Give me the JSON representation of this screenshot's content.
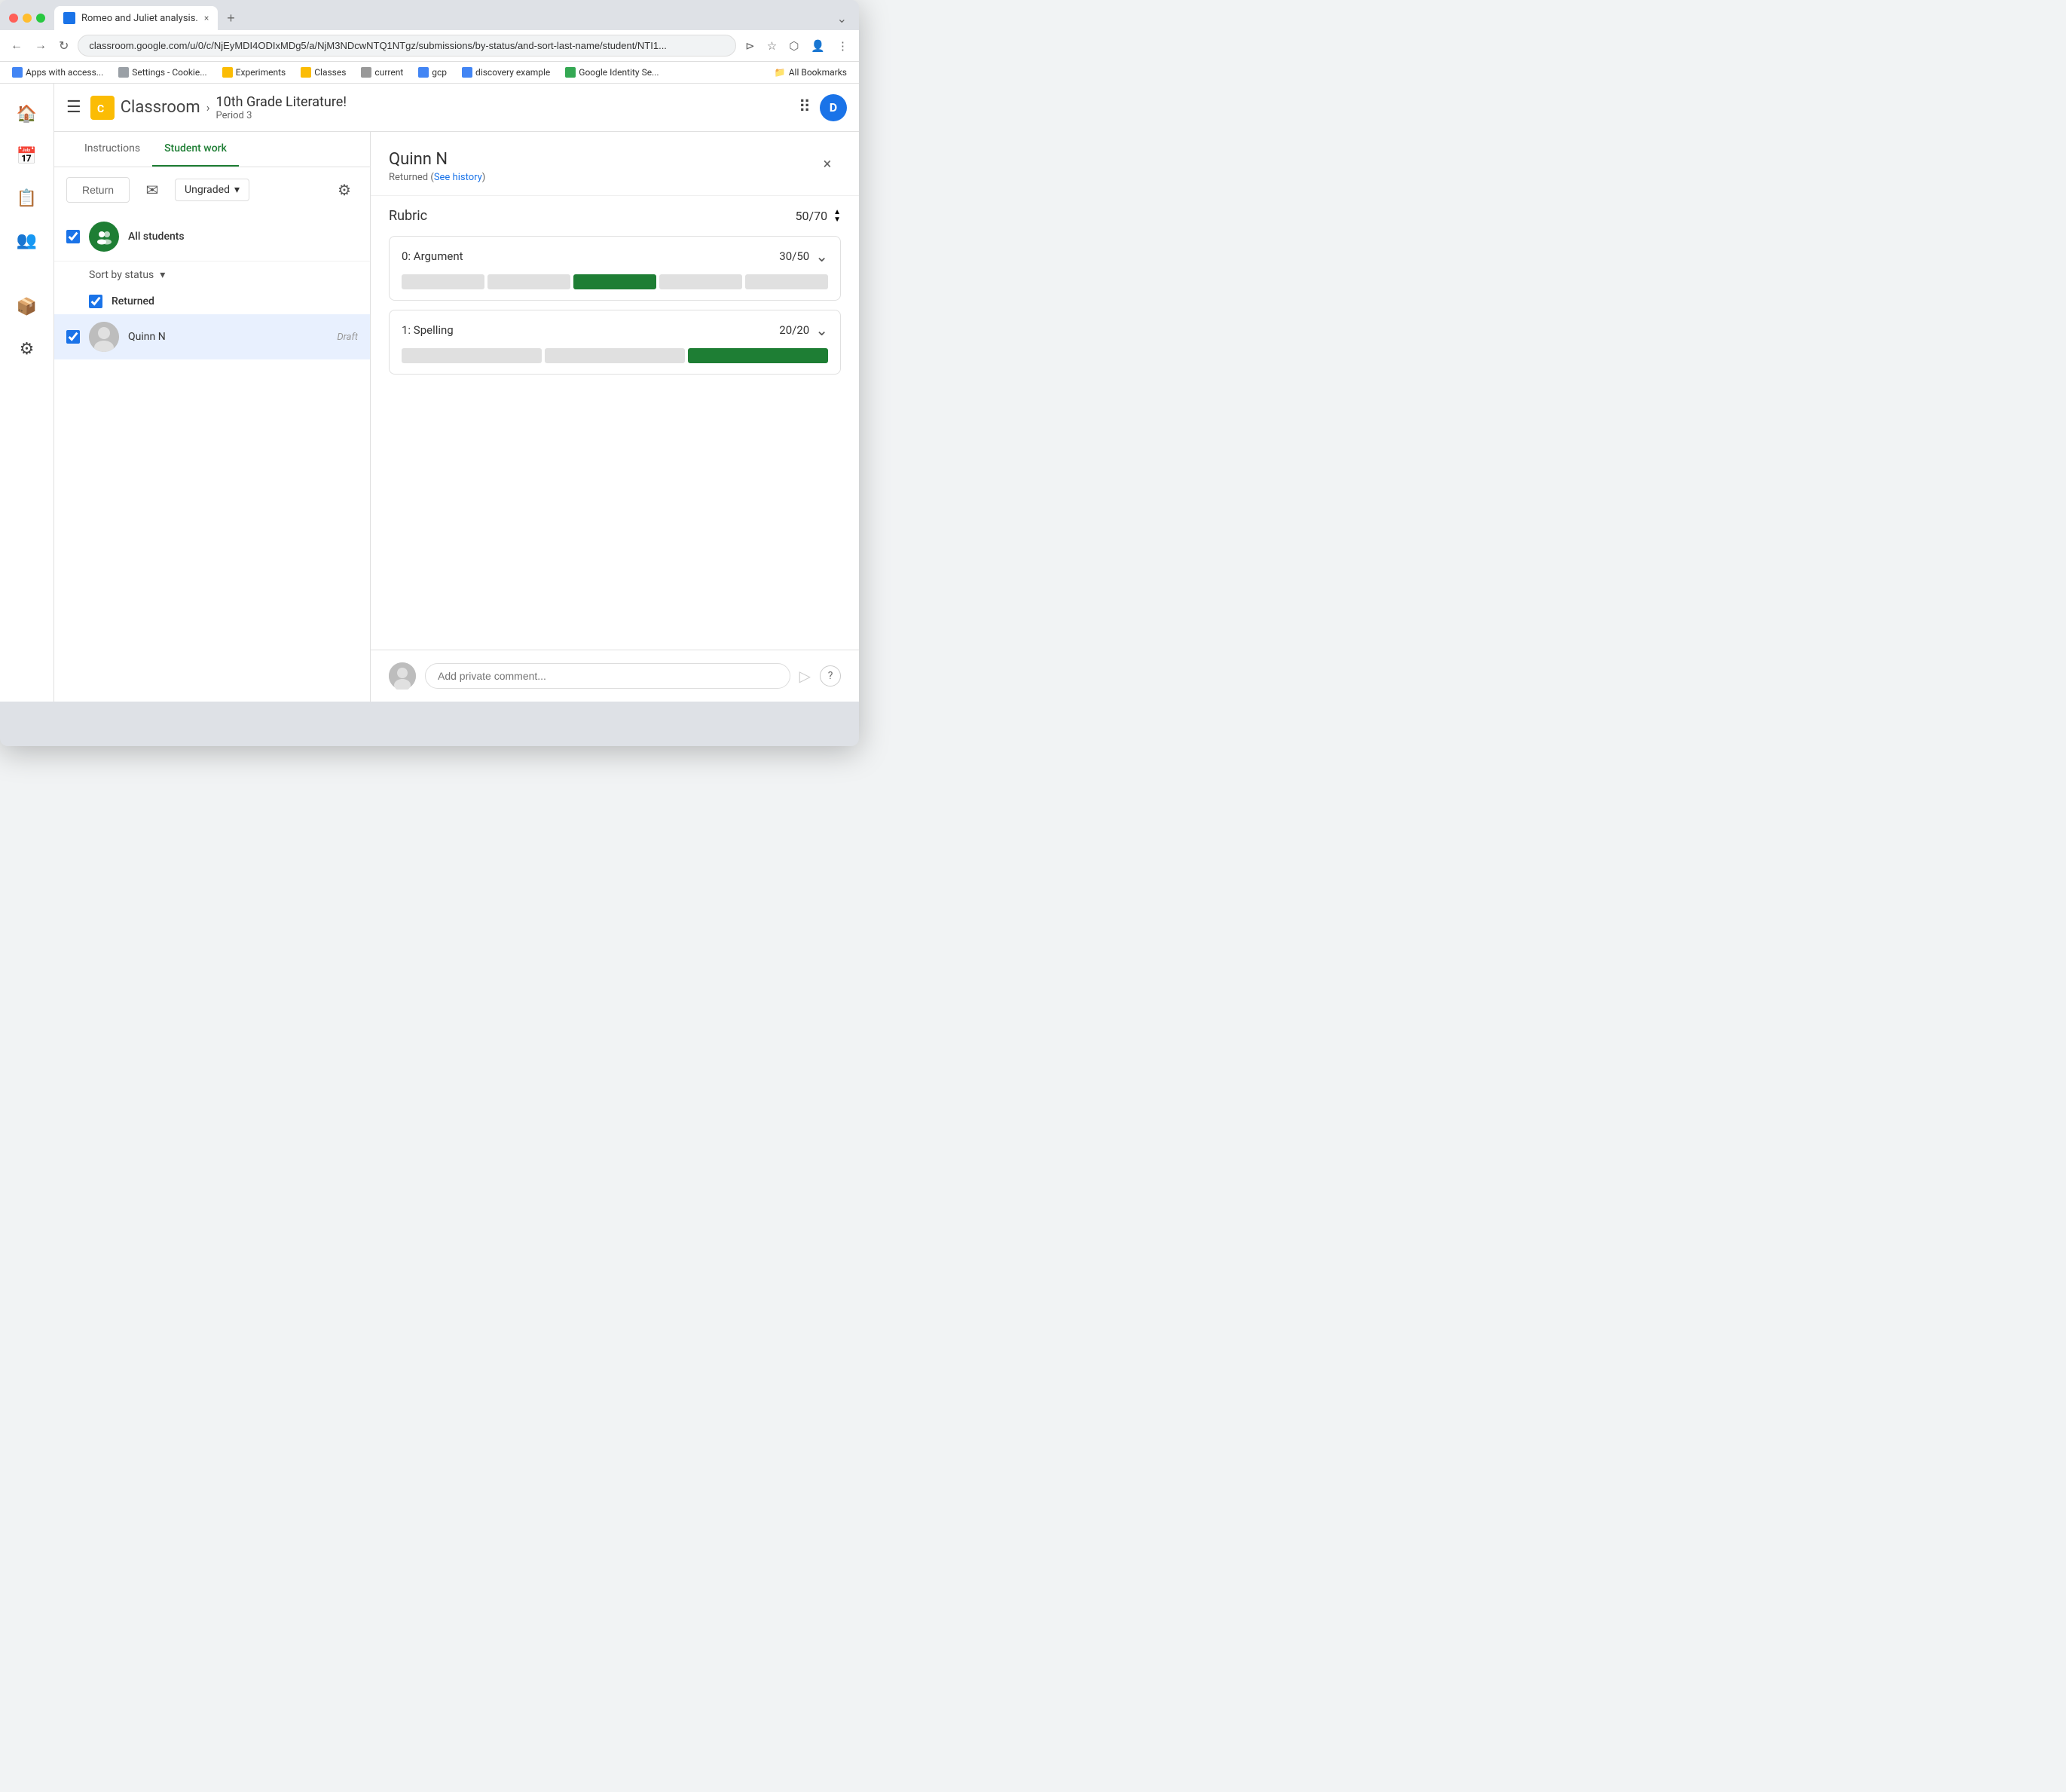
{
  "browser": {
    "tab_title": "Romeo and Juliet analysis.",
    "tab_new_label": "+",
    "address_bar": "classroom.google.com/u/0/c/NjEyMDI4ODIxMDg5/a/NjM3NDcwNTQ1NTgz/submissions/by-status/and-sort-last-name/student/NTI1...",
    "bookmarks": [
      {
        "label": "Apps with access...",
        "icon_color": "#4285f4"
      },
      {
        "label": "Settings - Cookie...",
        "icon_color": "#9aa0a6"
      },
      {
        "label": "Experiments",
        "icon_color": "#333"
      },
      {
        "label": "Classes",
        "icon_color": "#fbbc04"
      },
      {
        "label": "current",
        "icon_color": "#999"
      },
      {
        "label": "gcp",
        "icon_color": "#4285f4"
      },
      {
        "label": "discovery example",
        "icon_color": "#4285f4"
      },
      {
        "label": "Google Identity Se...",
        "icon_color": "#4285f4"
      },
      {
        "label": "All Bookmarks",
        "icon_color": "#999"
      }
    ]
  },
  "header": {
    "menu_icon": "☰",
    "logo_text": "Classroom",
    "logo_icon_text": "C",
    "breadcrumb_arrow": "›",
    "class_name": "10th Grade Literature!",
    "class_period": "Period 3",
    "apps_icon": "⠿",
    "avatar_letter": "D"
  },
  "sidebar_nav": {
    "items": [
      {
        "icon": "🏠",
        "name": "home"
      },
      {
        "icon": "📅",
        "name": "calendar"
      },
      {
        "icon": "📋",
        "name": "assignments"
      },
      {
        "icon": "👥",
        "name": "people"
      },
      {
        "icon": "📦",
        "name": "archive"
      },
      {
        "icon": "⚙",
        "name": "settings"
      }
    ]
  },
  "tabs": [
    {
      "label": "Instructions",
      "active": false
    },
    {
      "label": "Student work",
      "active": true
    }
  ],
  "toolbar": {
    "return_button_label": "Return",
    "email_icon": "✉",
    "status_label": "Ungraded",
    "dropdown_arrow": "▾",
    "settings_icon": "⚙"
  },
  "student_list": {
    "all_students_label": "All students",
    "sort_label": "Sort by status",
    "sort_arrow": "▾",
    "sections": [
      {
        "title": "Returned",
        "students": [
          {
            "name": "Quinn N",
            "status": "Draft",
            "selected": true
          }
        ]
      }
    ]
  },
  "student_detail": {
    "name": "Quinn N",
    "status_text": "Returned (See history)",
    "close_icon": "×",
    "rubric": {
      "title": "Rubric",
      "total_score": "50",
      "total_possible": "70",
      "items": [
        {
          "title": "0: Argument",
          "score": "30",
          "possible": "50",
          "segments": [
            0,
            0,
            1,
            0,
            0
          ],
          "active_segment": 2
        },
        {
          "title": "1: Spelling",
          "score": "20",
          "possible": "20",
          "segments": [
            0,
            0,
            1
          ],
          "active_segment": 2
        }
      ]
    }
  },
  "comment_area": {
    "placeholder": "Add private comment...",
    "send_icon": "▶",
    "help_icon": "?"
  },
  "colors": {
    "green_primary": "#1e7e34",
    "blue_primary": "#1a73e8",
    "selected_bg": "#e8f0fe"
  }
}
